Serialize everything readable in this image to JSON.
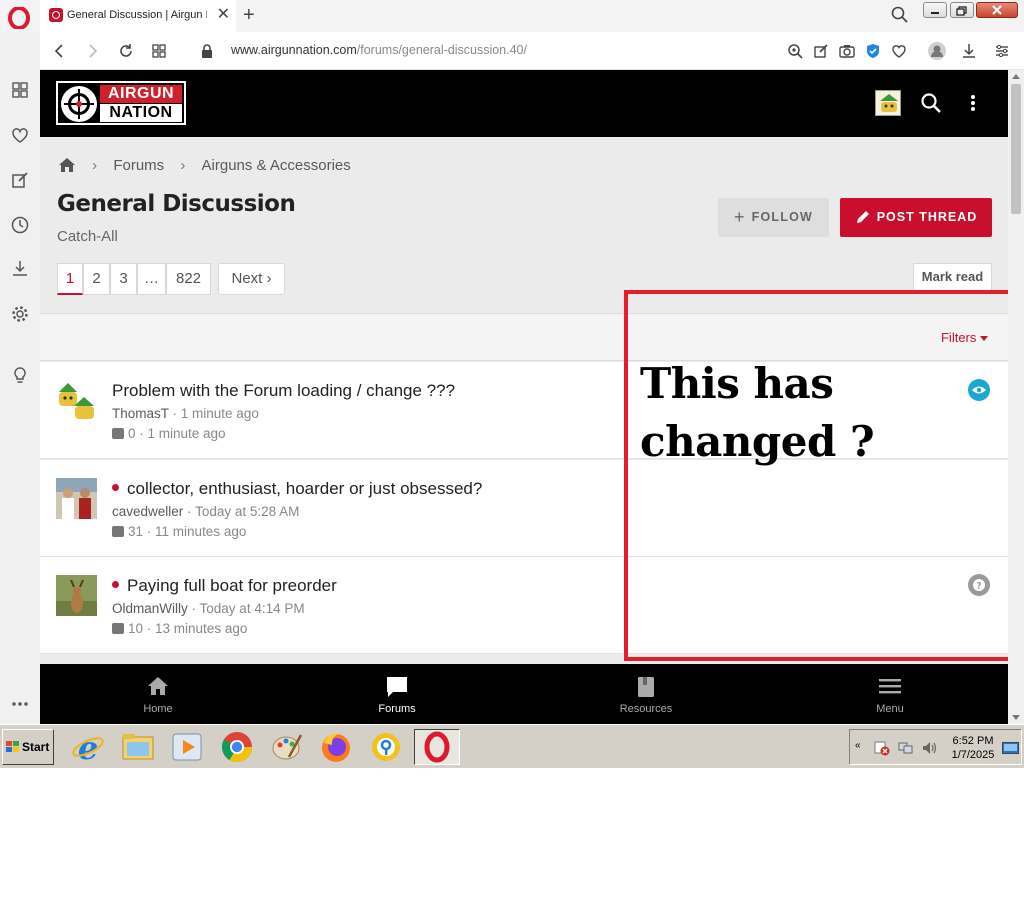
{
  "browser": {
    "tab_title": "General Discussion | Airgun N",
    "tab_close": "✕",
    "new_tab": "+",
    "url_host": "www.airgunnation.com",
    "url_path": "/forums/general-discussion.40/"
  },
  "site": {
    "logo_top": "AIRGUN",
    "logo_bottom": "NATION"
  },
  "breadcrumb": {
    "forums": "Forums",
    "category": "Airguns & Accessories",
    "separator": "›"
  },
  "forum": {
    "title": "General Discussion",
    "description": "Catch-All",
    "follow_label": "FOLLOW",
    "post_thread_label": "POST THREAD",
    "mark_read_label": "Mark read",
    "filters_label": "Filters"
  },
  "pagination": {
    "pages": [
      "1",
      "2",
      "3",
      "…",
      "822"
    ],
    "next_label": "Next ›"
  },
  "threads": [
    {
      "title": "Problem with the Forum loading / change ???",
      "user": "ThomasT",
      "started": "1 minute ago",
      "replies": "0",
      "last": "1 minute ago",
      "unread": false,
      "status_icon": "eye-icon",
      "status_color": "#1aa7d4"
    },
    {
      "title": "collector, enthusiast, hoarder or just obsessed?",
      "user": "cavedweller",
      "started": "Today at 5:28 AM",
      "replies": "31",
      "last": "11 minutes ago",
      "unread": true,
      "status_icon": "",
      "status_color": ""
    },
    {
      "title": "Paying full boat for preorder",
      "user": "OldmanWilly",
      "started": "Today at 4:14 PM",
      "replies": "10",
      "last": "13 minutes ago",
      "unread": true,
      "status_icon": "question-icon",
      "status_color": "#9a9a9a"
    }
  ],
  "annotation": {
    "line1": "This has",
    "line2": "changed ?",
    "color": "#e31e26"
  },
  "bottom_nav": [
    {
      "label": "Home",
      "icon": "home-icon"
    },
    {
      "label": "Forums",
      "icon": "chat-icon"
    },
    {
      "label": "Resources",
      "icon": "book-icon"
    },
    {
      "label": "Menu",
      "icon": "hamburger-icon"
    }
  ],
  "taskbar": {
    "start_label": "Start",
    "time": "6:52 PM",
    "date": "1/7/2025",
    "tray_arrow": "«"
  },
  "colors": {
    "brand_red": "#c8102e",
    "header_bg": "#000000"
  }
}
